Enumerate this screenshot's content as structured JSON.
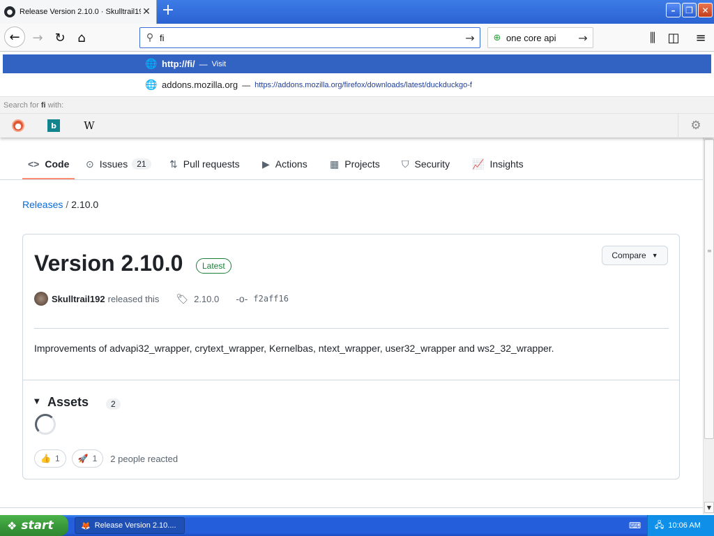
{
  "browser": {
    "tab_title": "Release Version 2.10.0 · Skulltrail19",
    "tab_close": "✕",
    "new_tab": "+",
    "window_buttons": {
      "minimize": "–",
      "maximize": "❐",
      "close": "✕"
    },
    "url_text": "fi",
    "search_engine_text": "one core api",
    "dropdown": {
      "suggestion1": {
        "main": "http://fi/",
        "sep": "—",
        "action": "Visit"
      },
      "suggestion2": {
        "main": "addons.mozilla.org",
        "sep": "—",
        "url": "https://addons.mozilla.org/firefox/downloads/latest/duckduckgo-f"
      },
      "search_for_prefix": "Search for ",
      "search_for_term": "fi",
      "search_for_suffix": " with:",
      "engines": [
        "duckduckgo-icon",
        "bing-icon",
        "wikipedia-icon"
      ],
      "engine_labels": {
        "bing": "b",
        "wiki": "W"
      }
    }
  },
  "repo_nav": {
    "tabs": [
      {
        "label": "Code",
        "icon": "<>"
      },
      {
        "label": "Issues",
        "icon": "⊙",
        "count": "21"
      },
      {
        "label": "Pull requests",
        "icon": "⇅"
      },
      {
        "label": "Actions",
        "icon": "▶"
      },
      {
        "label": "Projects",
        "icon": "▦"
      },
      {
        "label": "Security",
        "icon": "⛉"
      },
      {
        "label": "Insights",
        "icon": "📈"
      }
    ]
  },
  "breadcrumb": {
    "root": "Releases",
    "sep": "/",
    "current": "2.10.0"
  },
  "release": {
    "title": "Version 2.10.0",
    "badge": "Latest",
    "compare_label": "Compare",
    "author": "Skulltrail192",
    "released_text": "released this",
    "tag": "2.10.0",
    "commit": "f2aff16",
    "body": "Improvements of advapi32_wrapper, crytext_wrapper, Kernelbas, ntext_wrapper, user32_wrapper and ws2_32_wrapper.",
    "assets_title": "Assets",
    "assets_count": "2",
    "reactions": [
      {
        "emoji": "👍",
        "count": "1"
      },
      {
        "emoji": "🚀",
        "count": "1"
      }
    ],
    "reacted_text": "2 people reacted"
  },
  "taskbar": {
    "start_label": "start",
    "task_item": "Release Version 2.10....",
    "clock": "10:06 AM"
  }
}
